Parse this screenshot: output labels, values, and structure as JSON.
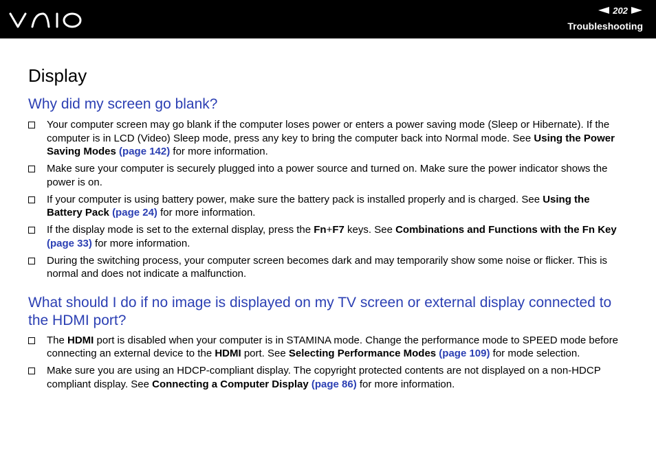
{
  "header": {
    "logo_icon": "vaio-logo",
    "page_number": "202",
    "section": "Troubleshooting"
  },
  "page": {
    "title": "Display",
    "sections": [
      {
        "heading": "Why did my screen go blank?",
        "items": [
          {
            "t1": "Your computer screen may go blank if the computer loses power or enters a power saving mode (Sleep or Hibernate). If the computer is in LCD (Video) Sleep mode, press any key to bring the computer back into Normal mode. See ",
            "b1": "Using the Power Saving Modes",
            "link": "(page 142)",
            "t2": " for more information."
          },
          {
            "t1": "Make sure your computer is securely plugged into a power source and turned on. Make sure the power indicator shows the power is on."
          },
          {
            "t1": "If your computer is using battery power, make sure the battery pack is installed properly and is charged. See ",
            "b1": "Using the Battery Pack",
            "link": "(page 24)",
            "t2": " for more information."
          },
          {
            "t1": "If the display mode is set to the external display, press the ",
            "fn": "Fn",
            "plus": "+",
            "f7": "F7",
            "t1b": " keys. See ",
            "b1": "Combinations and Functions with the Fn Key",
            "link": "(page 33)",
            "t2": " for more information."
          },
          {
            "t1": "During the switching process, your computer screen becomes dark and may temporarily show some noise or flicker. This is normal and does not indicate a malfunction."
          }
        ]
      },
      {
        "heading": "What should I do if no image is displayed on my TV screen or external display connected to the HDMI port?",
        "items": [
          {
            "t1": "The ",
            "b0": "HDMI",
            "t1b": " port is disabled when your computer is in STAMINA mode. Change the performance mode to SPEED mode before connecting an external device to the ",
            "b0b": "HDMI",
            "t1c": " port. See ",
            "b1": "Selecting Performance Modes",
            "link": "(page 109)",
            "t2": " for mode selection."
          },
          {
            "t1": "Make sure you are using an HDCP-compliant display. The copyright protected contents are not displayed on a non-HDCP compliant display. See ",
            "b1": "Connecting a Computer Display",
            "link": "(page 86)",
            "t2": " for more information."
          }
        ]
      }
    ]
  }
}
